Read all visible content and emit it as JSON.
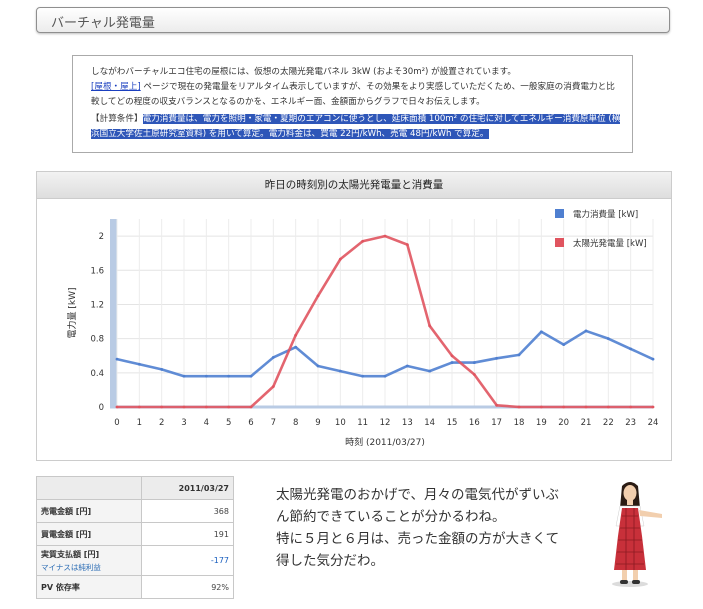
{
  "page": {
    "title": "バーチャル発電量"
  },
  "intro": {
    "line1": "しながわバーチャルエコ住宅の屋根には、仮想の太陽光発電パネル 3kW (およそ30m²) が設置されています。",
    "link": "[屋根・屋上]",
    "line2": " ページで現在の発電量をリアルタイム表示していますが、その効果をより実感していただくため、一般家庭の消費電力と比較してどの程度の収支バランスとなるのかを、エネルギー面、金額面からグラフで日々お伝えします。",
    "calc_label": "【計算条件】",
    "calc_text": "電力消費量は、電力を照明・家電・夏期のエアコンに使うとし、延床面積 100m² の住宅に対してエネルギー消費原単位 (横浜国立大学佐土原研究室資料) を用いて算定。電力料金は、買電 22円/kWh、売電 48円/kWh で算定。"
  },
  "chart_data": {
    "type": "line",
    "title": "昨日の時刻別の太陽光発電量と消費量",
    "xlabel": "時刻 (2011/03/27)",
    "ylabel": "電力量 [kW]",
    "xlim": [
      0,
      24
    ],
    "ylim": [
      0,
      2.2
    ],
    "xticks": [
      "0",
      "1",
      "2",
      "3",
      "4",
      "5",
      "6",
      "7",
      "8",
      "9",
      "10",
      "11",
      "12",
      "13",
      "14",
      "15",
      "16",
      "17",
      "18",
      "19",
      "20",
      "21",
      "22",
      "23",
      "24"
    ],
    "yticks": [
      "0",
      "0.4",
      "0.8",
      "1.2",
      "1.6",
      "2"
    ],
    "grid": true,
    "legend_position": "top-right",
    "x": [
      0,
      1,
      2,
      3,
      4,
      5,
      6,
      7,
      8,
      9,
      10,
      11,
      12,
      13,
      14,
      15,
      16,
      17,
      18,
      19,
      20,
      21,
      22,
      23,
      24
    ],
    "series": [
      {
        "name": "電力消費量 [kW]",
        "color": "#4f7fd0",
        "values": [
          0.56,
          0.5,
          0.44,
          0.36,
          0.36,
          0.36,
          0.36,
          0.58,
          0.7,
          0.48,
          0.42,
          0.36,
          0.36,
          0.48,
          0.42,
          0.52,
          0.52,
          0.57,
          0.61,
          0.88,
          0.73,
          0.89,
          0.8,
          0.68,
          0.56
        ]
      },
      {
        "name": "太陽光発電量 [kW]",
        "color": "#e0545f",
        "values": [
          0,
          0,
          0,
          0,
          0,
          0,
          0,
          0.24,
          0.84,
          1.3,
          1.73,
          1.94,
          2.0,
          1.9,
          0.95,
          0.6,
          0.38,
          0.02,
          0,
          0,
          0,
          0,
          0,
          0,
          0
        ]
      }
    ]
  },
  "summary": {
    "date": "2011/03/27",
    "rows": [
      {
        "label": "売電金額 [円]",
        "value": "368"
      },
      {
        "label": "買電金額 [円]",
        "value": "191"
      },
      {
        "label": "実質支払額 [円]",
        "sub": "マイナスは純利益",
        "value": "-177"
      },
      {
        "label": "PV 依存率",
        "value": "92%"
      }
    ]
  },
  "speech": {
    "lines": [
      "太陽光発電のおかげで、月々の電気代がずいぶ",
      "ん節約できていることが分かるわね。",
      "特に５月と６月は、売った金額の方が大きくて",
      "得した気分だわ。"
    ]
  }
}
